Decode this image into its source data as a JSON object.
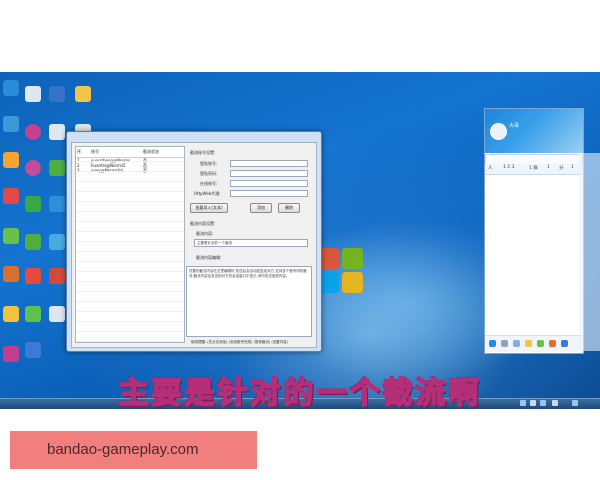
{
  "colors": {
    "desktop_blue": "#1474d0",
    "subtitle_outline": "#b52f78",
    "watermark_bg": "#f07f7e"
  },
  "desktop_icons": [
    {
      "name": "app-icon-orange",
      "label": "",
      "color": "#f2a233"
    },
    {
      "name": "document-icon",
      "label": "",
      "color": "#dfe8f2"
    },
    {
      "name": "video-icon",
      "label": "",
      "color": "#3572c8"
    },
    {
      "name": "folder-icon",
      "label": "",
      "color": "#f1c44a"
    }
  ],
  "main_window": {
    "list": {
      "columns": [
        "序",
        "账号",
        "截流状态"
      ],
      "rows": [
        [
          "1",
          "yuanzheng@Norms",
          "否"
        ],
        [
          "2",
          "huanfei@Norms5",
          "否"
        ],
        [
          "3",
          "aney@Norms(b)",
          "否"
        ]
      ]
    },
    "form": {
      "section_title": "截流账号设置:",
      "labels": [
        "登陆账号:",
        "登陆密码:",
        "在线账号:",
        "HttpWeb代理:"
      ],
      "buttons": [
        "批量导入(文本)",
        "添加",
        "删除"
      ],
      "settings_title": "截流内容设置:",
      "content_label": "截流内容:",
      "content_value": "主要是针对的一个截流",
      "log_label": "截流内容编辑:",
      "log_text": "您要的截流内容在这里编辑好,发送后会自动回复给对方,支持多个账号同时截流,截流内容会发送到对方的会话窗口中显示,请勿发送违规内容。",
      "footer": "使用提醒: (先点击添加) (添加账号完成) (登录截流) (设置内容)"
    }
  },
  "qq_panel": {
    "name": "大哥",
    "signature": "",
    "tabs": [
      "人",
      "1 2 3",
      "1 群",
      "1",
      "分",
      "1"
    ],
    "list_items": [
      "",
      ""
    ]
  },
  "subtitle": "主要是针对的一个截流啊",
  "watermark": "bandao-gameplay.com"
}
